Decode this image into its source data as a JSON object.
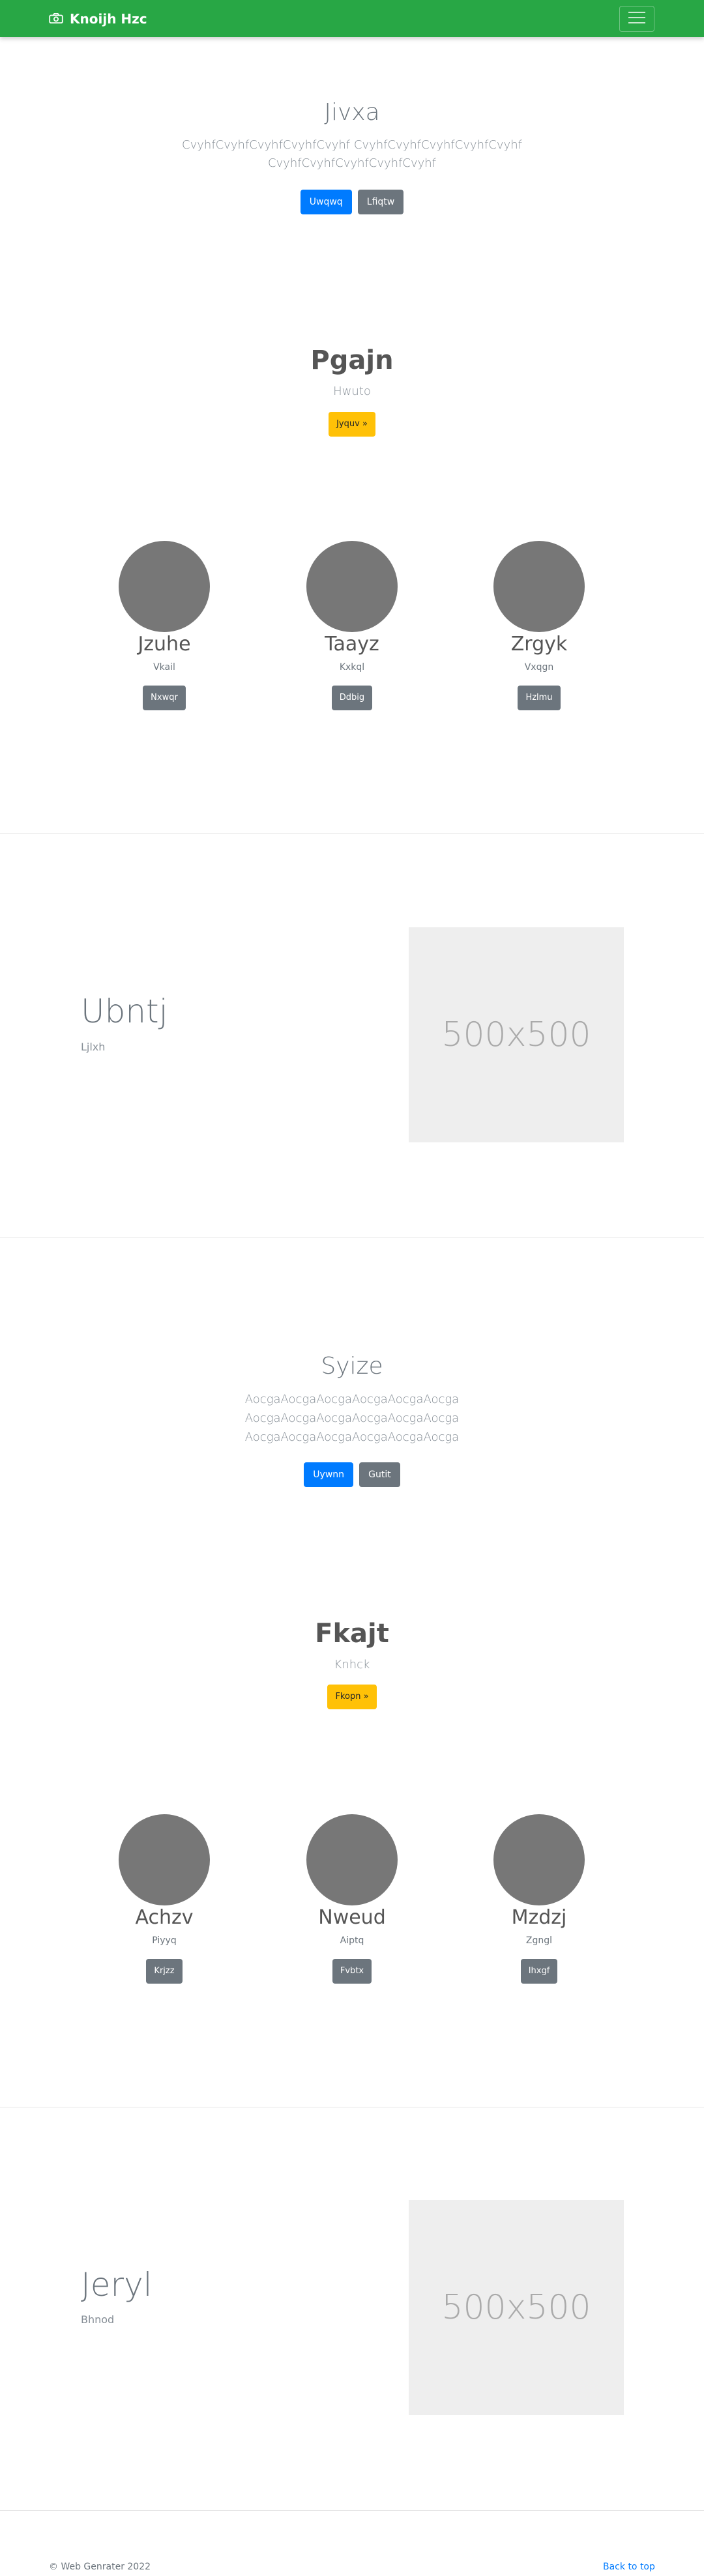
{
  "navbar": {
    "brand": "Knoijh Hzc",
    "brand_icon": "camera-icon",
    "toggler_icon": "hamburger-menu-icon",
    "bg_color": "#28a745"
  },
  "hero1": {
    "title": "Jivxa",
    "text_line1": "CvyhfCvyhfCvyhfCvyhfCvyhf CvyhfCvyhfCvyhfCvyhfCvyhf",
    "text_line2": "CvyhfCvyhfCvyhfCvyhfCvyhf",
    "primary_button": "Uwqwq",
    "secondary_button": "Lfiqtw"
  },
  "cta1": {
    "title": "Pgajn",
    "subtitle": "Hwuto",
    "button": "Jyquv »"
  },
  "team1": [
    {
      "name": "Jzuhe",
      "role": "Vkail",
      "button": "Nxwqr"
    },
    {
      "name": "Taayz",
      "role": "Kxkql",
      "button": "Ddbig"
    },
    {
      "name": "Zrgyk",
      "role": "Vxqgn",
      "button": "Hzlmu"
    }
  ],
  "feature1": {
    "title": "Ubntj",
    "subtitle": "Ljlxh",
    "image_label": "500x500"
  },
  "hero2": {
    "title": "Syize",
    "text_line1": "AocgaAocgaAocgaAocgaAocgaAocga",
    "text_line2": "AocgaAocgaAocgaAocgaAocgaAocga",
    "text_line3": "AocgaAocgaAocgaAocgaAocgaAocga",
    "primary_button": "Uywnn",
    "secondary_button": "Gutit"
  },
  "cta2": {
    "title": "Fkajt",
    "subtitle": "Knhck",
    "button": "Fkopn »"
  },
  "team2": [
    {
      "name": "Achzv",
      "role": "Piyyq",
      "button": "Krjzz"
    },
    {
      "name": "Nweud",
      "role": "Aiptq",
      "button": "Fvbtx"
    },
    {
      "name": "Mzdzj",
      "role": "Zgngl",
      "button": "Ihxgf"
    }
  ],
  "feature2": {
    "title": "Jeryl",
    "subtitle": "Bhnod",
    "image_label": "500x500"
  },
  "footer": {
    "copyright": "© Web Genrater 2022",
    "back_to_top": "Back to top"
  }
}
